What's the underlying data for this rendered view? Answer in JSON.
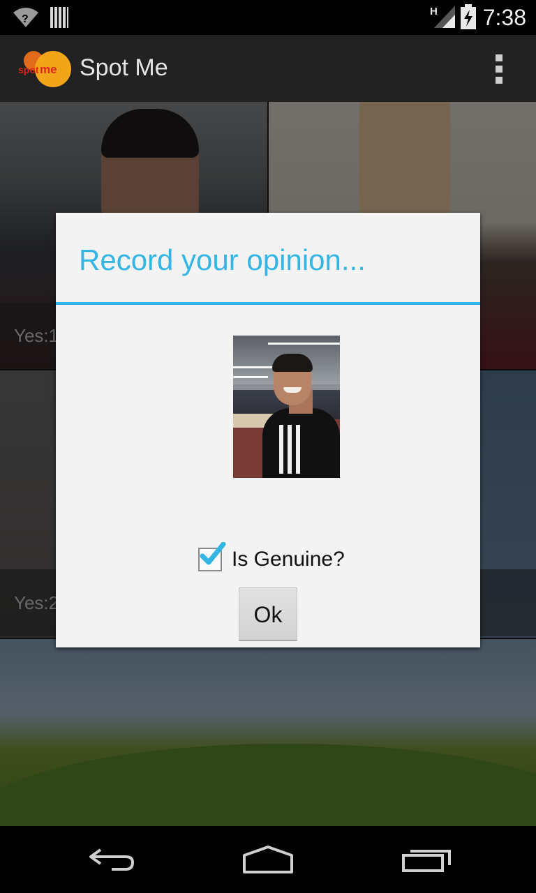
{
  "status_bar": {
    "time": "7:38",
    "network_type": "H",
    "icons": [
      "wifi-help-icon",
      "barcode-icon",
      "signal-icon",
      "battery-charging-icon"
    ]
  },
  "action_bar": {
    "logo_text": "spotme",
    "title": "Spot Me",
    "menu_icon": "overflow-menu-icon"
  },
  "grid": {
    "tiles": [
      {
        "label": "Yes:1"
      },
      {
        "label": "Yes:2"
      }
    ]
  },
  "dialog": {
    "title": "Record your opinion...",
    "checkbox": {
      "label": "Is Genuine?",
      "checked": true
    },
    "ok_label": "Ok"
  },
  "nav_bar": {
    "buttons": [
      "back-icon",
      "home-icon",
      "recent-apps-icon"
    ]
  },
  "colors": {
    "accent": "#33b5e5",
    "dialog_bg": "#f3f3f3",
    "actionbar_bg": "#222222"
  }
}
